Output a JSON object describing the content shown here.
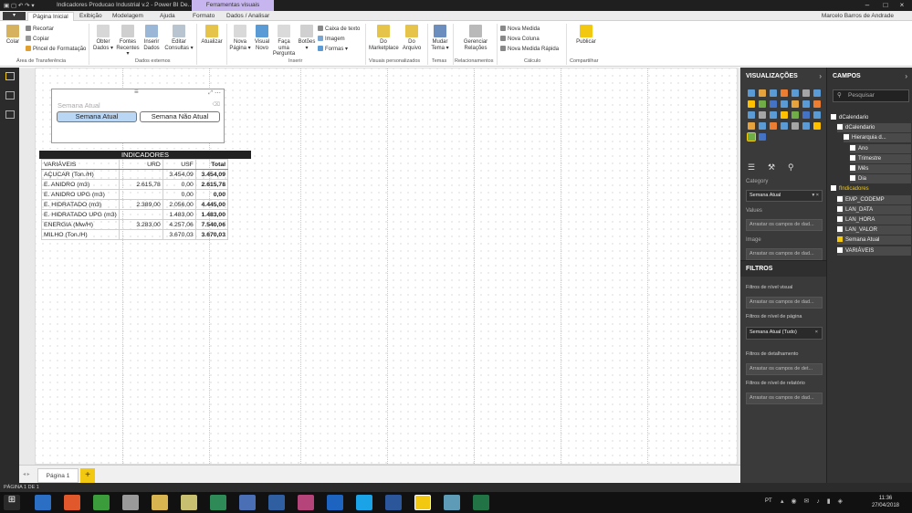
{
  "window": {
    "title": "Indicadores Producao Industrial v.2 - Power BI De...",
    "context_tab": "Ferramentas visuais",
    "user": "Marcelo Barros de Andrade"
  },
  "tabs": [
    "Página Inicial",
    "Exibição",
    "Modelagem",
    "Ajuda",
    "Formato",
    "Dados / Analisar"
  ],
  "file_label": "▾",
  "ribbon": {
    "clipboard": {
      "paste": "Colar",
      "cut": "Recortar",
      "copy": "Copiar",
      "format_painter": "Pincel de Formatação",
      "group": "Área de Transferência"
    },
    "data": {
      "get_data": "Obter Dados ▾",
      "recent": "Fontes Recentes ▾",
      "enter": "Inserir Dados",
      "edit": "Editar Consultas ▾",
      "group": "Dados externos"
    },
    "refresh": "Atualizar",
    "insert": {
      "new_page": "Nova Página ▾",
      "new_visual": "Visual Novo",
      "ask": "Faça uma Pergunta",
      "buttons": "Botões ▾",
      "textbox": "Caixa de texto",
      "image": "Imagem",
      "shapes": "Formas ▾",
      "group": "Inserir"
    },
    "custom": {
      "marketplace": "Do Marketplace",
      "file": "Do Arquivo",
      "group": "Visuais personalizados"
    },
    "themes": {
      "switch": "Mudar Tema ▾",
      "group": "Temas"
    },
    "relationships": {
      "manage": "Gerenciar Relações",
      "group": "Relacionamentos"
    },
    "calc": {
      "measure": "Nova Medida",
      "column": "Nova Coluna",
      "quick": "Nova Medida Rápida",
      "group": "Cálculo"
    },
    "share": {
      "publish": "Publicar",
      "group": "Compartilhar"
    }
  },
  "slicer": {
    "header": "Semana Atual",
    "options": [
      "Semana Atual",
      "Semana Não Atual"
    ],
    "selected": 0
  },
  "matrix": {
    "title": "INDICADORES",
    "columns": [
      "VARIÁVEIS",
      "URD",
      "USF",
      "Total"
    ],
    "rows": [
      [
        "AÇUCAR (Ton./H)",
        "",
        "3.454,09",
        "3.454,09"
      ],
      [
        "E. ANIDRO (m3)",
        "2.615,78",
        "0,00",
        "2.615,78"
      ],
      [
        "E. ANIDRO UPG (m3)",
        "",
        "0,00",
        "0,00"
      ],
      [
        "E. HIDRATADO (m3)",
        "2.389,00",
        "2.056,00",
        "4.445,00"
      ],
      [
        "E. HIDRATADO UPG (m3)",
        "",
        "1.483,00",
        "1.483,00"
      ],
      [
        "ENERGIA (Mw/H)",
        "3.283,00",
        "4.257,06",
        "7.540,06"
      ],
      [
        "MILHO (Ton./H)",
        "",
        "3.670,03",
        "3.670,03"
      ]
    ]
  },
  "page_tab": "Página 1",
  "add_page": "+",
  "status": "PÁGINA 1 DE 1",
  "viz_pane": {
    "title": "VISUALIZAÇÕES",
    "category_label": "Category",
    "category_value": "Semana Atual",
    "values_label": "Values",
    "values_placeholder": "Arrastar os campos de dad...",
    "image_label": "Image",
    "image_placeholder": "Arrastar os campos de dad..."
  },
  "filters": {
    "title": "FILTROS",
    "visual_level": "Filtros de nível visual",
    "visual_drop": "Arrastar os campos de dad...",
    "page_level": "Filtros de nível de página",
    "page_filter": "Semana Atual (Tudo)",
    "drill": "Filtros de detalhamento",
    "drill_drop": "Arrastar os campos de det...",
    "report_level": "Filtros de nível de relatório",
    "report_drop": "Arrastar os campos de dad..."
  },
  "fields": {
    "title": "CAMPOS",
    "search_placeholder": "Pesquisar",
    "items": [
      {
        "label": "dCalendario",
        "indent": 0,
        "checked": false
      },
      {
        "label": "dCalendario",
        "indent": 1,
        "checked": false
      },
      {
        "label": "Hierarquia d...",
        "indent": 2,
        "checked": false
      },
      {
        "label": "Ano",
        "indent": 3,
        "checked": false
      },
      {
        "label": "Trimestre",
        "indent": 3,
        "checked": false
      },
      {
        "label": "Mês",
        "indent": 3,
        "checked": false
      },
      {
        "label": "Dia",
        "indent": 3,
        "checked": false
      },
      {
        "label": "fIndicadores",
        "indent": 0,
        "checked": false,
        "accent": true
      },
      {
        "label": "EMP_CODEMP",
        "indent": 1,
        "checked": false
      },
      {
        "label": "LAN_DATA",
        "indent": 1,
        "checked": false
      },
      {
        "label": "LAN_HORA",
        "indent": 1,
        "checked": false
      },
      {
        "label": "LAN_VALOR",
        "indent": 1,
        "checked": false
      },
      {
        "label": "Semana Atual",
        "indent": 1,
        "checked": true
      },
      {
        "label": "VARIÁVEIS",
        "indent": 1,
        "checked": false
      }
    ]
  },
  "taskbar": {
    "lang": "PT",
    "time": "11:36",
    "date": "27/04/2018"
  },
  "colors": {
    "accent": "#f2c811",
    "pane": "#3a3a3a",
    "slicer_selected": "#b9d6f5"
  }
}
